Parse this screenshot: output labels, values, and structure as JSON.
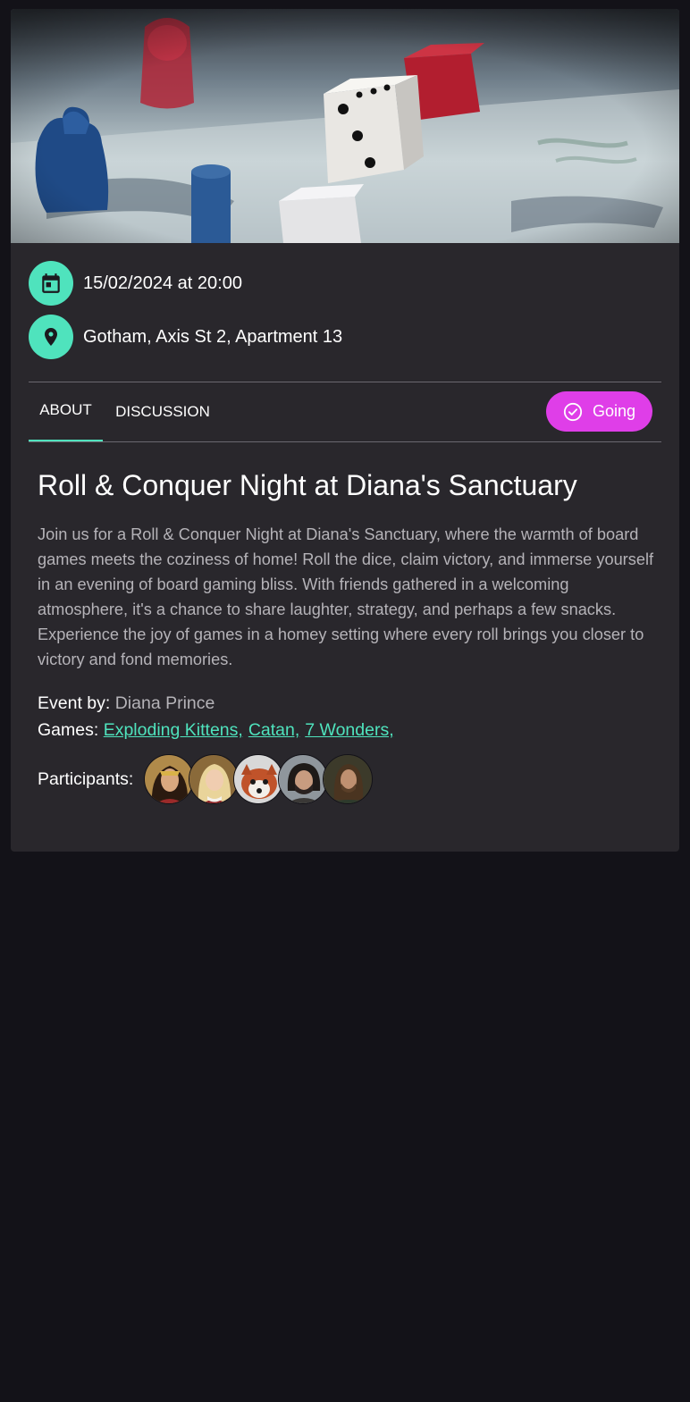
{
  "event": {
    "datetime": "15/02/2024 at 20:00",
    "location": "Gotham, Axis St 2, Apartment 13",
    "title": "Roll & Conquer Night at Diana's Sanctuary",
    "description": "Join us for a Roll & Conquer Night at Diana's Sanctuary, where the warmth of board games meets the coziness of home! Roll the dice, claim victory, and immerse yourself in an evening of board gaming bliss. With friends gathered in a welcoming atmosphere, it's a chance to share laughter, strategy, and perhaps a few snacks. Experience the joy of games in a homey setting where every roll brings you closer to victory and fond memories.",
    "event_by_label": "Event by:",
    "event_by": "Diana Prince",
    "games_label": "Games:",
    "games": [
      "Exploding Kittens,",
      "Catan,",
      "7 Wonders,"
    ],
    "participants_label": "Participants:",
    "participants_count": 5
  },
  "tabs": {
    "about": "ABOUT",
    "discussion": "DISCUSSION",
    "active": "about"
  },
  "actions": {
    "going_label": "Going"
  },
  "icons": {
    "datetime": "calendar-icon",
    "location": "location-pin-icon",
    "going": "check-circle-icon"
  },
  "colors": {
    "accent": "#4fe3bd",
    "going_button": "#df3ee8",
    "card_bg": "#29272c",
    "page_bg": "#131218"
  }
}
